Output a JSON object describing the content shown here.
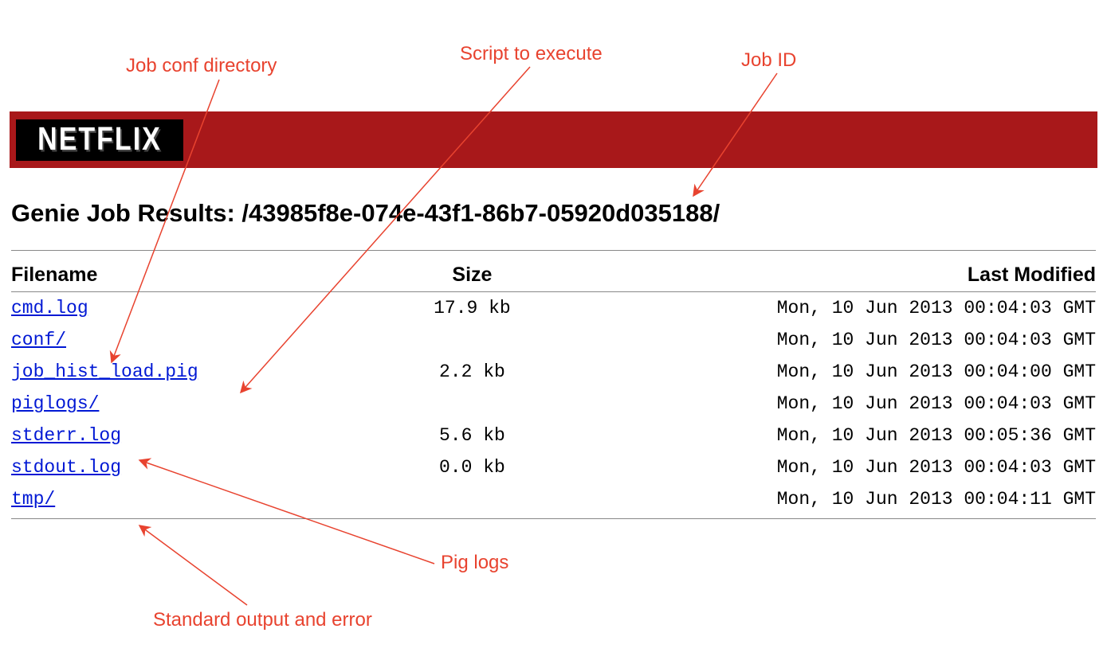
{
  "annotations": {
    "jobconf": "Job conf directory",
    "script": "Script to execute",
    "jobid": "Job ID",
    "piglogs": "Pig logs",
    "stdouterr": "Standard output and error"
  },
  "logo": "NETFLIX",
  "page_title_prefix": "Genie Job Results: ",
  "job_id": "/43985f8e-074e-43f1-86b7-05920d035188/",
  "columns": {
    "filename": "Filename",
    "size": "Size",
    "last_modified": "Last Modified"
  },
  "files": [
    {
      "name": "cmd.log",
      "size": "17.9 kb",
      "date": "Mon, 10 Jun 2013 00:04:03 GMT"
    },
    {
      "name": "conf/",
      "size": "",
      "date": "Mon, 10 Jun 2013 00:04:03 GMT"
    },
    {
      "name": "job_hist_load.pig",
      "size": "2.2 kb",
      "date": "Mon, 10 Jun 2013 00:04:00 GMT"
    },
    {
      "name": "piglogs/",
      "size": "",
      "date": "Mon, 10 Jun 2013 00:04:03 GMT"
    },
    {
      "name": "stderr.log",
      "size": "5.6 kb",
      "date": "Mon, 10 Jun 2013 00:05:36 GMT"
    },
    {
      "name": "stdout.log",
      "size": "0.0 kb",
      "date": "Mon, 10 Jun 2013 00:04:03 GMT"
    },
    {
      "name": "tmp/",
      "size": "",
      "date": "Mon, 10 Jun 2013 00:04:11 GMT"
    }
  ]
}
